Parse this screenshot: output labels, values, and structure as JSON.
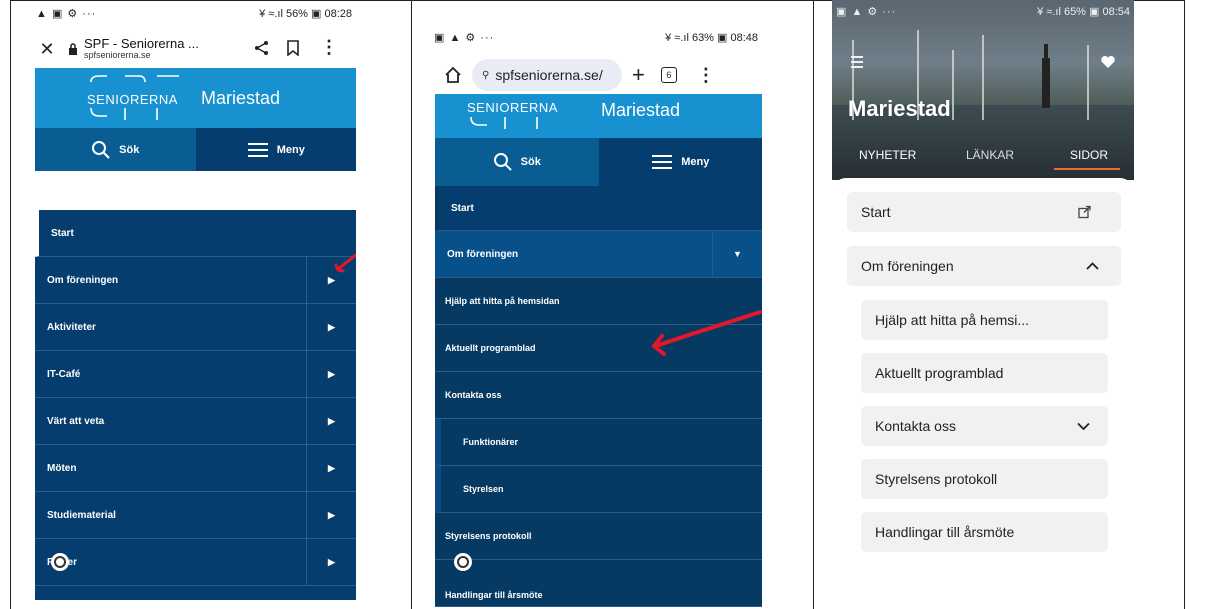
{
  "panel1": {
    "status": {
      "left_icons": "▲ ▣ ⚙ ···",
      "right": "¥ ≈.ıl 56% ▣ 08:28"
    },
    "url": {
      "title": "SPF - Seniorerna ...",
      "domain": "spfseniorerna.se"
    },
    "header": {
      "logo_top": "SENIORERNA",
      "city": "Mariestad"
    },
    "tabs": {
      "search": "Sök",
      "menu": "Meny"
    },
    "menu": [
      "Start",
      "Om föreningen",
      "Aktiviteter",
      "IT-Café",
      "Värt att veta",
      "Möten",
      "Studiematerial",
      "F   ner"
    ]
  },
  "panel2": {
    "status": {
      "left_icons": "▣ ▲ ⚙ ···",
      "right": "¥ ≈.ıl 63% ▣ 08:48"
    },
    "url": {
      "text": "spfseniorerna.se/",
      "tab_count": "6"
    },
    "header": {
      "logo_top": "SENIORERNA",
      "city": "Mariestad"
    },
    "tabs": {
      "search": "Sök",
      "menu": "Meny"
    },
    "start": "Start",
    "om": "Om föreningen",
    "sub": [
      "Hjälp att hitta på hemsidan",
      "Aktuellt programblad",
      "Kontakta oss"
    ],
    "subsub": [
      "Funktionärer",
      "Styrelsen"
    ],
    "more": [
      "Styrelsens protokoll",
      "Handlingar till årsmöte"
    ]
  },
  "panel3": {
    "status": {
      "left_icons": "▣ ▲ ⚙ ···",
      "right": "¥ ≈.ıl 65% ▣ 08:54"
    },
    "title": "Mariestad",
    "tabs": [
      "NYHETER",
      "LÄNKAR",
      "SIDOR"
    ],
    "items": {
      "start": "Start",
      "om": "Om föreningen",
      "hjalp": "Hjälp att hitta på hemsi...",
      "aktuellt": "Aktuellt programblad",
      "kontakta": "Kontakta oss",
      "protokoll": "Styrelsens protokoll",
      "handlingar": "Handlingar till årsmöte"
    }
  },
  "colors": {
    "brand_blue": "#1791cf",
    "navy": "#053e6e",
    "arrow_red": "#e3172b",
    "tab_accent": "#e86a3a"
  }
}
